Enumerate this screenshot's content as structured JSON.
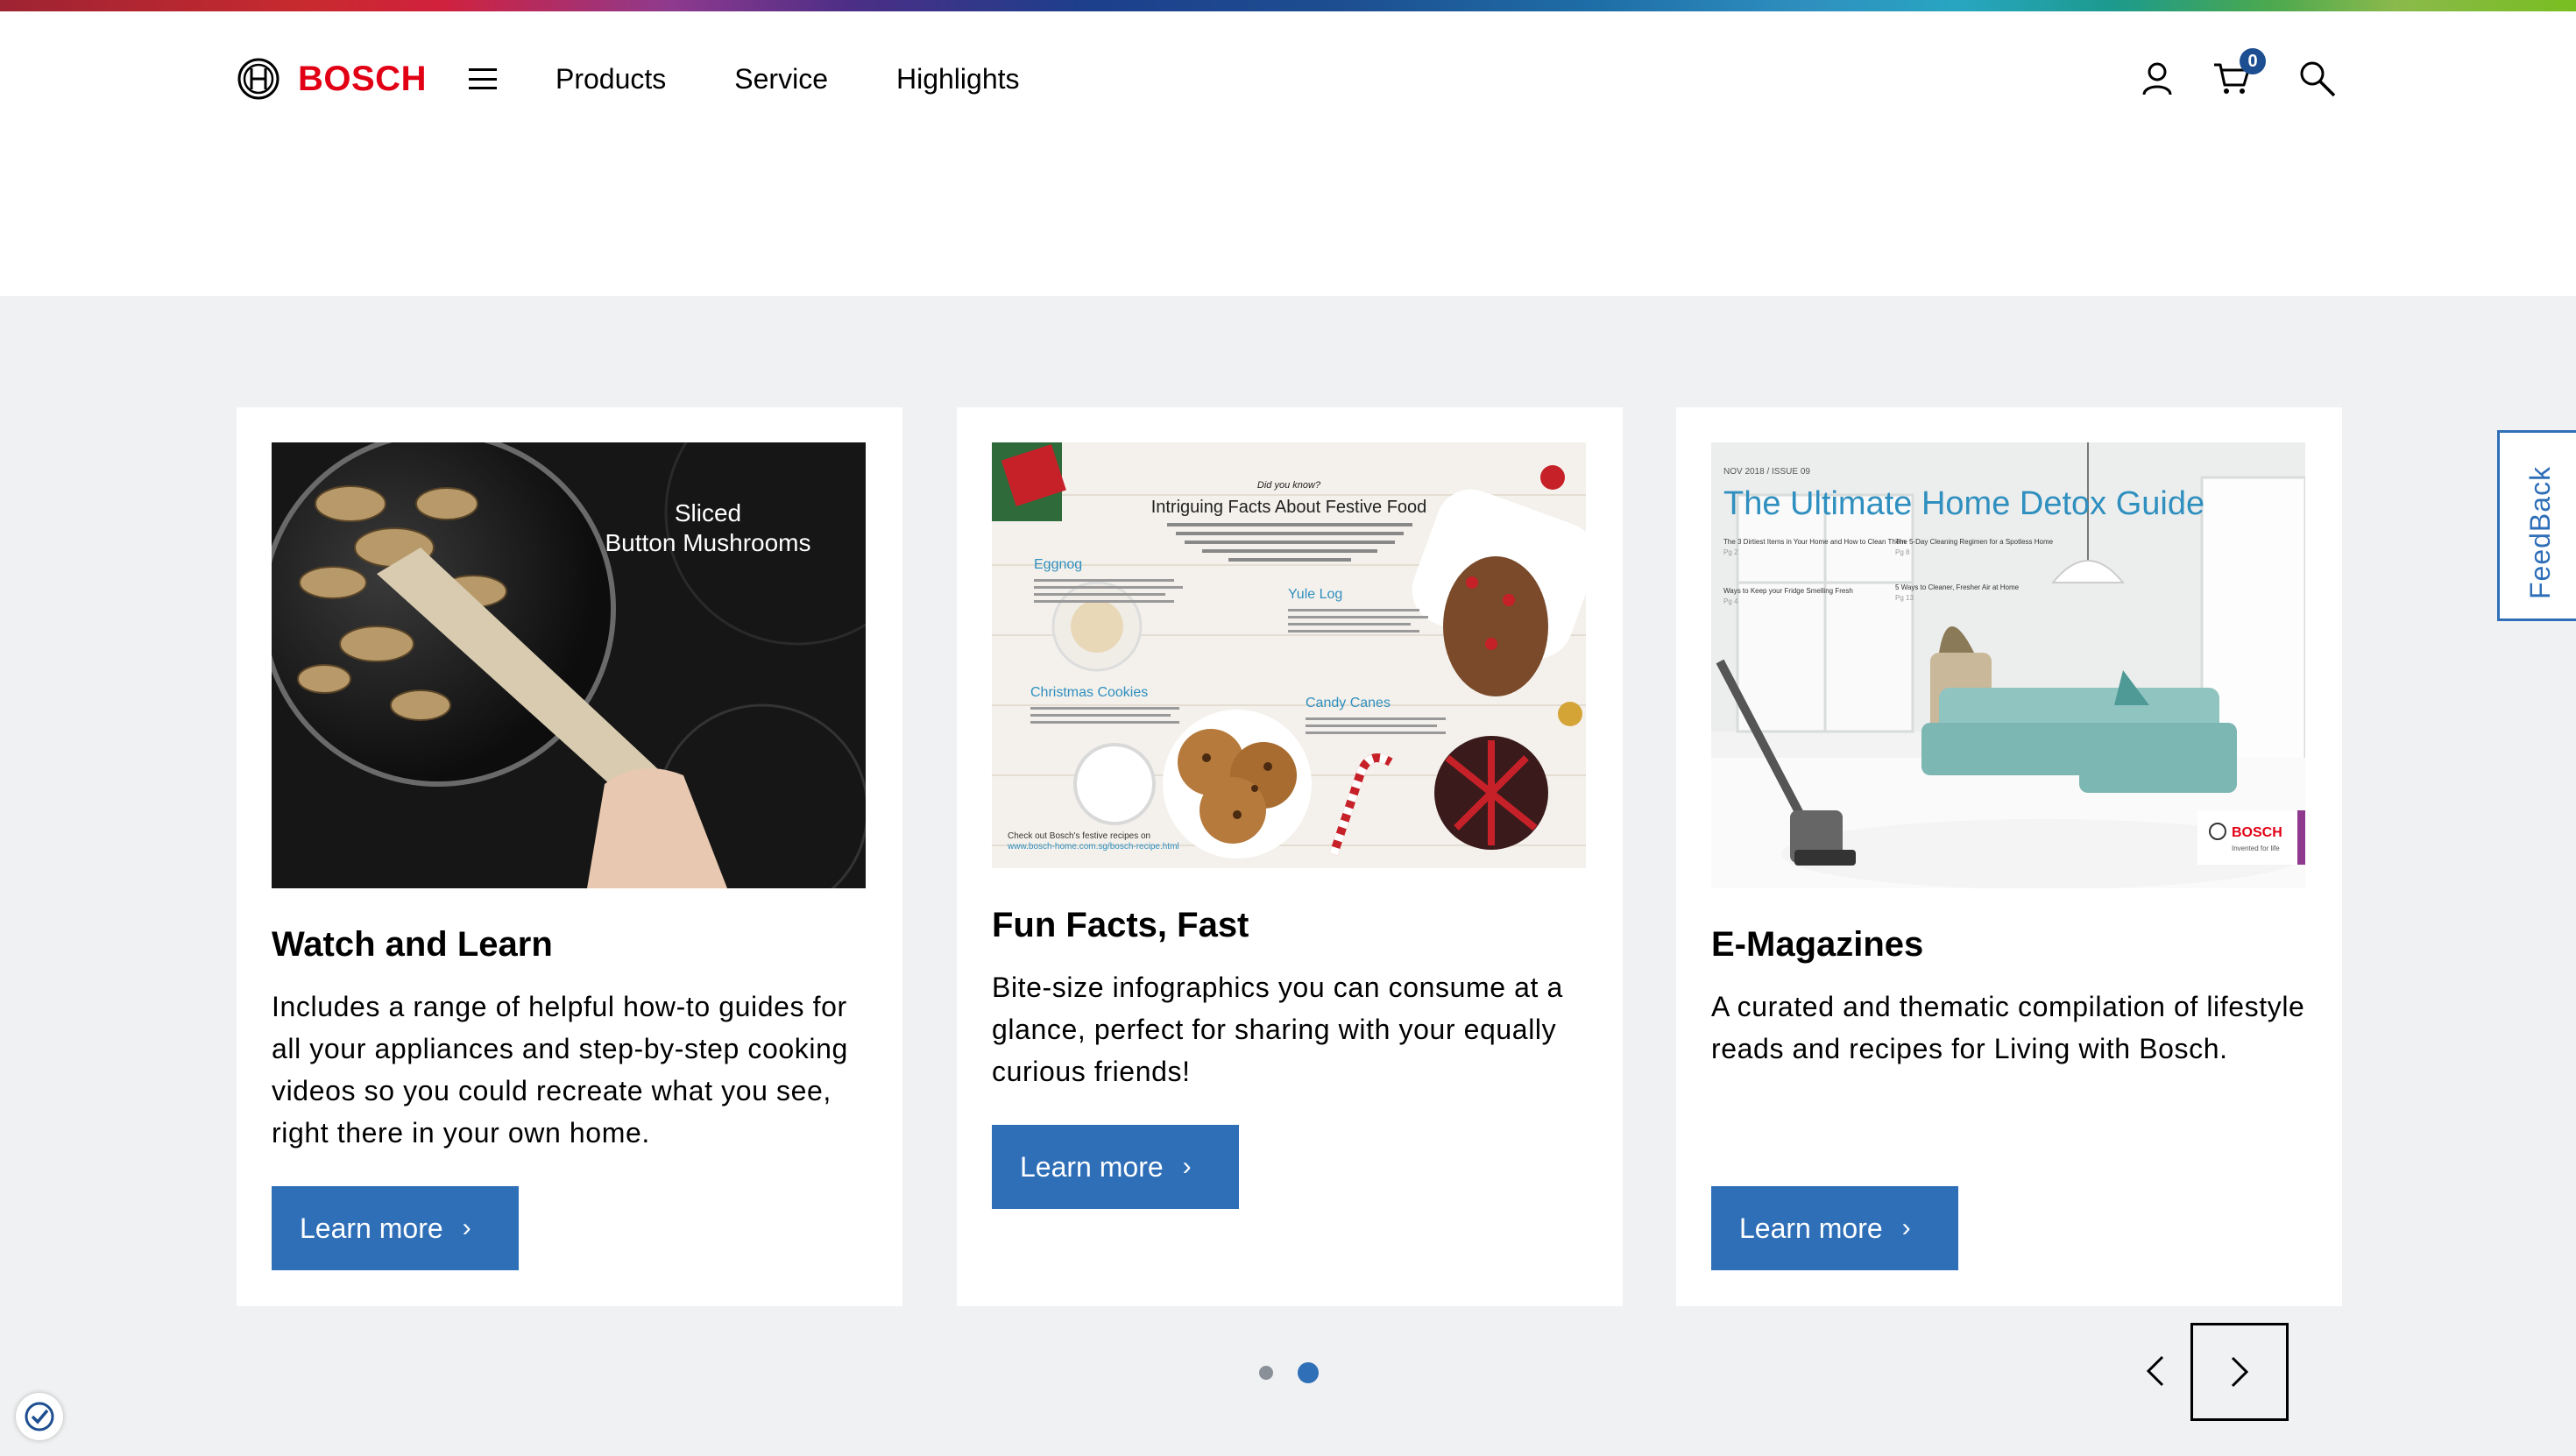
{
  "brand": {
    "name": "BOSCH",
    "accent": "#e20015",
    "blue": "#2f6fb8"
  },
  "nav": {
    "items": [
      "Products",
      "Service",
      "Highlights"
    ]
  },
  "header": {
    "cart_count": "0"
  },
  "cards": [
    {
      "title": "Watch and Learn",
      "text": "Includes a range of helpful how-to guides for all your appliances and step-by-step cooking videos so you could recreate what you see, right there in your own home.",
      "button": "Learn more",
      "image_caption": [
        "Sliced",
        "Button Mushrooms"
      ]
    },
    {
      "title": "Fun Facts, Fast",
      "text": "Bite-size infographics you can consume at a glance, perfect for sharing with your equally curious friends!",
      "button": "Learn more",
      "image": {
        "kicker": "Did you know?",
        "headline": "Intriguing Facts About Festive Food",
        "labels": [
          "Eggnog",
          "Yule Log",
          "Christmas Cookies",
          "Candy Canes"
        ],
        "footer": "Check out Bosch's festive recipes on",
        "link": "www.bosch-home.com.sg/bosch-recipe.html"
      }
    },
    {
      "title": "E-Magazines",
      "text": "A curated and thematic compilation of lifestyle reads and recipes for Living with Bosch.",
      "button": "Learn more",
      "image": {
        "issue": "NOV 2018 / ISSUE 09",
        "headline": "The Ultimate Home Detox Guide",
        "teasers": [
          {
            "t": "The 3 Dirtiest Items in Your Home and How to Clean Them",
            "p": "Pg 2"
          },
          {
            "t": "The 5-Day Cleaning Regimen for a Spotless Home",
            "p": "Pg 8"
          },
          {
            "t": "Ways to Keep your Fridge Smelling Fresh",
            "p": "Pg 4"
          },
          {
            "t": "5 Ways to Cleaner, Fresher Air at Home",
            "p": "Pg 13"
          }
        ],
        "logo": "BOSCH",
        "tagline": "Invented for life"
      }
    }
  ],
  "feedback": "FeedBack",
  "carousel": {
    "pages": 2,
    "active": 2
  }
}
